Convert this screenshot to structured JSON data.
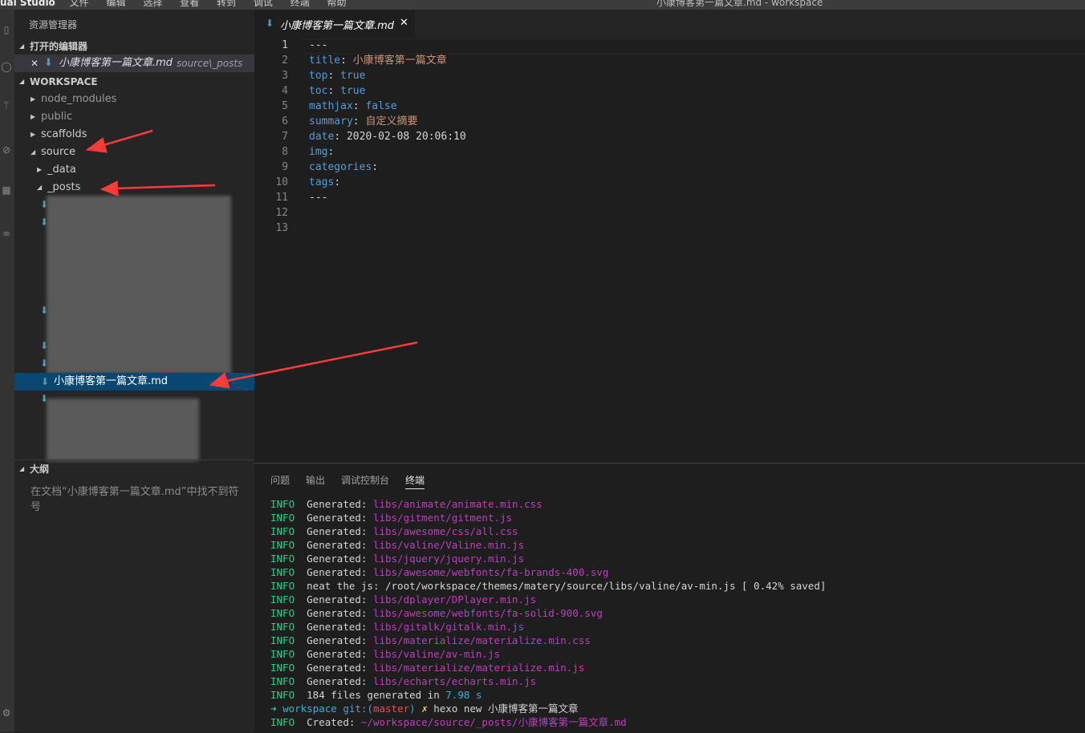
{
  "titlebar": {
    "app": "ual Studio",
    "menu": [
      "文件",
      "编辑",
      "选择",
      "查看",
      "转到",
      "调试",
      "终端",
      "帮助"
    ],
    "window_title": "小康博客第一篇文章.md - workspace"
  },
  "sidebar": {
    "title": "资源管理器",
    "open_editors": {
      "header": "打开的编辑器",
      "item": {
        "name": "小康博客第一篇文章.md",
        "path": "source\\_posts"
      }
    },
    "workspace": {
      "header": "WORKSPACE",
      "items": [
        "node_modules",
        "public",
        "scaffolds",
        "source",
        "_data",
        "_posts"
      ],
      "selected_file": "小康博客第一篇文章.md"
    },
    "outline": {
      "header": "大纲",
      "message": "在文档“小康博客第一篇文章.md”中找不到符号"
    }
  },
  "editor": {
    "tab": {
      "name": "小康博客第一篇文章.md"
    },
    "lines": [
      {
        "n": "1",
        "key": "---",
        "sep": "",
        "val": "",
        "type": "plain"
      },
      {
        "n": "2",
        "key": "title",
        "sep": ": ",
        "val": "小康博客第一篇文章",
        "type": "string"
      },
      {
        "n": "3",
        "key": "top",
        "sep": ": ",
        "val": "true",
        "type": "bool"
      },
      {
        "n": "4",
        "key": "toc",
        "sep": ": ",
        "val": "true",
        "type": "bool"
      },
      {
        "n": "5",
        "key": "mathjax",
        "sep": ": ",
        "val": "false",
        "type": "bool"
      },
      {
        "n": "6",
        "key": "summary",
        "sep": ": ",
        "val": "自定义摘要",
        "type": "string"
      },
      {
        "n": "7",
        "key": "date",
        "sep": ": ",
        "val": "2020-02-08 20:06:10",
        "type": "date"
      },
      {
        "n": "8",
        "key": "img",
        "sep": ":",
        "val": "",
        "type": "key"
      },
      {
        "n": "9",
        "key": "categories",
        "sep": ":",
        "val": "",
        "type": "key"
      },
      {
        "n": "10",
        "key": "tags",
        "sep": ":",
        "val": "",
        "type": "key"
      },
      {
        "n": "11",
        "key": "---",
        "sep": "",
        "val": "",
        "type": "plain"
      },
      {
        "n": "12",
        "key": "",
        "sep": "",
        "val": "",
        "type": "plain"
      },
      {
        "n": "13",
        "key": "",
        "sep": "",
        "val": "",
        "type": "plain"
      }
    ]
  },
  "panel": {
    "tabs": [
      "问题",
      "输出",
      "调试控制台",
      "终端"
    ],
    "active_tab": "终端",
    "terminal": {
      "generated": [
        "libs/animate/animate.min.css",
        "libs/gitment/gitment.js",
        "libs/awesome/css/all.css",
        "libs/valine/Valine.min.js",
        "libs/jquery/jquery.min.js",
        "libs/awesome/webfonts/fa-brands-400.svg"
      ],
      "neat_line": "neat the js: /root/workspace/themes/matery/source/libs/valine/av-min.js [ 0.42% saved]",
      "generated2": [
        "libs/dplayer/DPlayer.min.js",
        "libs/awesome/webfonts/fa-solid-900.svg",
        "libs/gitalk/gitalk.min.js",
        "libs/materialize/materialize.min.css",
        "libs/valine/av-min.js",
        "libs/materialize/materialize.min.js",
        "libs/echarts/echarts.min.js"
      ],
      "info_label": "INFO",
      "generated_label": "Generated:",
      "summary_text": "184 files generated in",
      "summary_time": "7.98 s",
      "prompt_arrow": "➜",
      "prompt_dir": "workspace",
      "prompt_git": "git:(",
      "prompt_branch": "master",
      "prompt_git_close": ")",
      "prompt_x": "✗",
      "command": "hexo new 小康博客第一篇文章",
      "created_label": "Created:",
      "created_path": "~/workspace/source/_posts/小康博客第一篇文章.md"
    }
  },
  "colors": {
    "editor_bg": "#1e1e1e",
    "sidebar_bg": "#252526",
    "selection": "#094771",
    "annotation_arrow": "#ff3b3b",
    "md_file_icon": "#519aba"
  }
}
